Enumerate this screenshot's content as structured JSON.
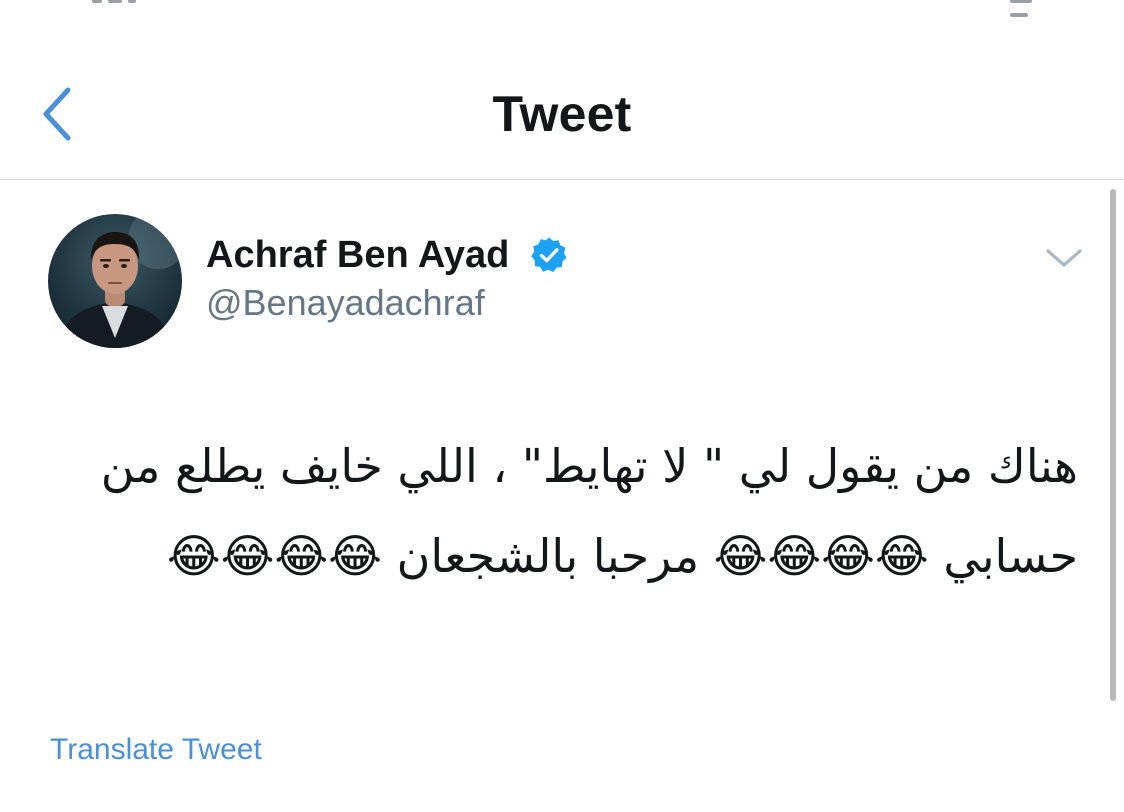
{
  "nav": {
    "title": "Tweet",
    "back_icon": "chevron-left-icon",
    "accent_color": "#4a90d9"
  },
  "tweet": {
    "author_name": "Achraf Ben Ayad",
    "author_handle": "@Benayadachraf",
    "verified": true,
    "verified_icon": "verified-badge-icon",
    "verified_color": "#1da1f2",
    "menu_icon": "chevron-down-icon",
    "text": "هناك من يقول لي \" لا تهايط\" ، اللي خايف يطلع من حسابي 😂😂😂😂 مرحبا بالشجعان 😂😂😂😂",
    "translate_label": "Translate Tweet"
  }
}
